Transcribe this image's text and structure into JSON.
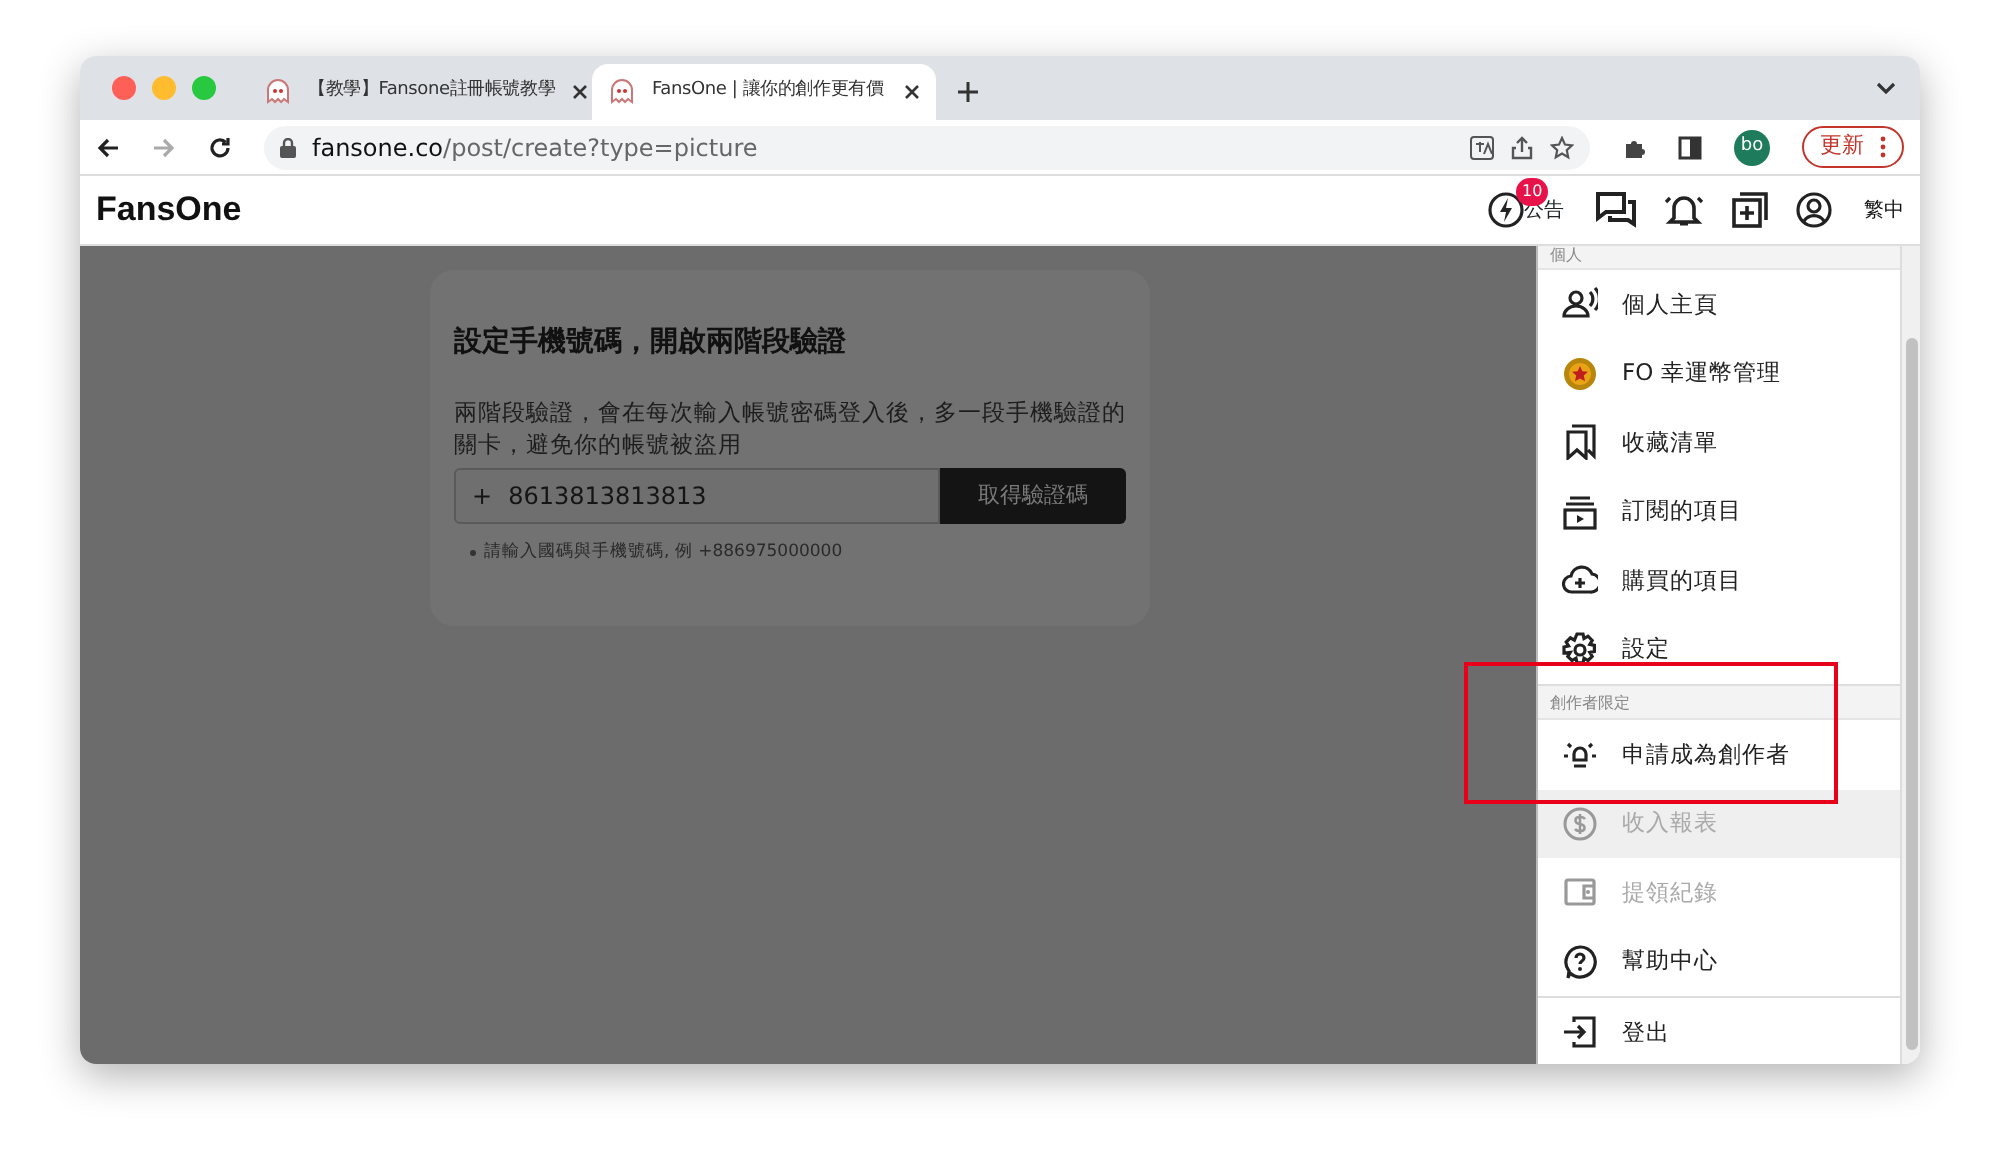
{
  "browser": {
    "tabs": [
      {
        "title": "【教學】Fansone註冊帳號教學",
        "selected": false
      },
      {
        "title": "FansOne | 讓你的創作更有價",
        "selected": true
      }
    ],
    "url": {
      "host": "fansone.co",
      "path": "/post/create?type=picture"
    },
    "profile": "bo",
    "update_button": "更新"
  },
  "header": {
    "logo": "FansOne",
    "announce_label": "公告",
    "announce_badge": "10",
    "language": "繁中"
  },
  "card": {
    "title": "設定手機號碼，開啟兩階段驗證",
    "description": "兩階段驗證，會在每次輸入帳號密碼登入後，多一段手機驗證的關卡，避免你的帳號被盜用",
    "prefix": "+",
    "phone": "8613813813813",
    "button": "取得驗證碼",
    "hint": "請輸入國碼與手機號碼, 例 +886975000000"
  },
  "menu": {
    "sections": [
      {
        "title": "個人",
        "items": [
          {
            "kind": "profile",
            "label": "個人主頁",
            "disabled": false,
            "highlighted": false
          },
          {
            "kind": "coin",
            "label": "FO 幸運幣管理",
            "disabled": false,
            "highlighted": false
          },
          {
            "kind": "bookmark",
            "label": "收藏清單",
            "disabled": false,
            "highlighted": false
          },
          {
            "kind": "subscribe",
            "label": "訂閱的項目",
            "disabled": false,
            "highlighted": false
          },
          {
            "kind": "cloud",
            "label": "購買的項目",
            "disabled": false,
            "highlighted": false
          },
          {
            "kind": "gear",
            "label": "設定",
            "disabled": false,
            "highlighted": false
          }
        ]
      },
      {
        "title": "創作者限定",
        "items": [
          {
            "kind": "bulb",
            "label": "申請成為創作者",
            "disabled": false,
            "highlighted": false
          },
          {
            "kind": "dollar",
            "label": "收入報表",
            "disabled": true,
            "highlighted": true
          },
          {
            "kind": "wallet",
            "label": "提領紀錄",
            "disabled": true,
            "highlighted": false
          },
          {
            "kind": "help",
            "label": "幫助中心",
            "disabled": false,
            "highlighted": false
          }
        ]
      },
      {
        "items": [
          {
            "kind": "logout",
            "label": "登出",
            "disabled": false,
            "highlighted": false
          }
        ]
      }
    ]
  }
}
